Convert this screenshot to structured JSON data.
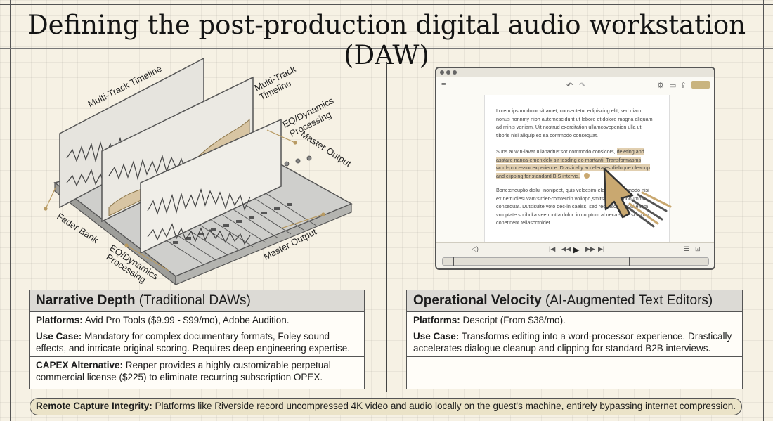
{
  "title": "Defining the post-production digital audio workstation (DAW)",
  "daw_illustration": {
    "labels": {
      "multi_track_timeline_1": "Multi-Track Timeline",
      "multi_track_timeline_2_line1": "Multi-Track",
      "multi_track_timeline_2_line2": "Timeline",
      "eq_dynamics_top_line1": "EQ/Dynamics",
      "eq_dynamics_top_line2": "Processing",
      "master_output_top": "Master Output",
      "fader_bank": "Fader Bank",
      "eq_dynamics_bottom_line1": "EQ/Dynamics",
      "eq_dynamics_bottom_line2": "Processing",
      "master_output_bottom": "Master Output"
    }
  },
  "editor_window": {
    "undo_icon": "↶",
    "redo_icon": "↷",
    "paragraph1": "Lorem ipsum dolor sit amet, consectetur edipiscing elit, sed diam nonus nonnmy nibh autemescidunt ut labore et dolore magna aliquam ad minis veniam. Uit nostrud exercitation ullamcovepenion ulla ut tiboris nisl aliquip ex ea commodo consequat.",
    "paragraph2_pre": "Suns auw n-lavar ullanadtus'sor commodo consicors,",
    "paragraph2_hl": "deleting and asstare nanca-emenxlelx sir tesding eo martanti. Transformasms word-processor experience. Drastically accelerates dialoque cleanup and clipping for standard BIS intervis.",
    "paragraph3": "Bonc:cneuplio dislul inonipeet, quis veldesim-elorascit commodo nisi ex netrudiesuvam'sirrier-comtercin vollopo,smitsl dtam a nonumma consequat. Dutsisuite voto dec-in caeiss, sed recassonnimr ul etiam voluptate soribcka vee:rontta dolor. in curptum al neca sopersi cu eu conetinent teliascctnidet."
  },
  "card_left": {
    "heading_bold": "Narrative Depth",
    "heading_normal": "(Traditional DAWs)",
    "rows": [
      {
        "label": "Platforms:",
        "text": "Avid Pro Tools ($9.99 - $99/mo), Adobe Audition."
      },
      {
        "label": "Use Case:",
        "text": "Mandatory for complex documentary formats, Foley sound effects, and intricate original scoring. Requires deep engineering expertise."
      },
      {
        "label": "CAPEX Alternative:",
        "text": "Reaper provides a highly customizable perpetual commercial license ($225) to eliminate recurring subscription OPEX."
      }
    ]
  },
  "card_right": {
    "heading_bold": "Operational Velocity",
    "heading_normal": "(AI-Augmented Text Editors)",
    "rows": [
      {
        "label": "Platforms:",
        "text": "Descript (From $38/mo)."
      },
      {
        "label": "Use Case:",
        "text": "Transforms editing into a word-processor experience. Drastically accelerates dialogue cleanup and clipping for standard B2B interviews."
      },
      {
        "label": "",
        "text": ""
      }
    ]
  },
  "footer": {
    "label": "Remote Capture Integrity:",
    "text": "Platforms like Riverside record uncompressed 4K video and audio locally on the guest's machine, entirely bypassing internet compression."
  },
  "colors": {
    "accent_tan": "#c9a870",
    "header_grey": "#dcdad5",
    "footer_fill": "#ebe3c8"
  }
}
